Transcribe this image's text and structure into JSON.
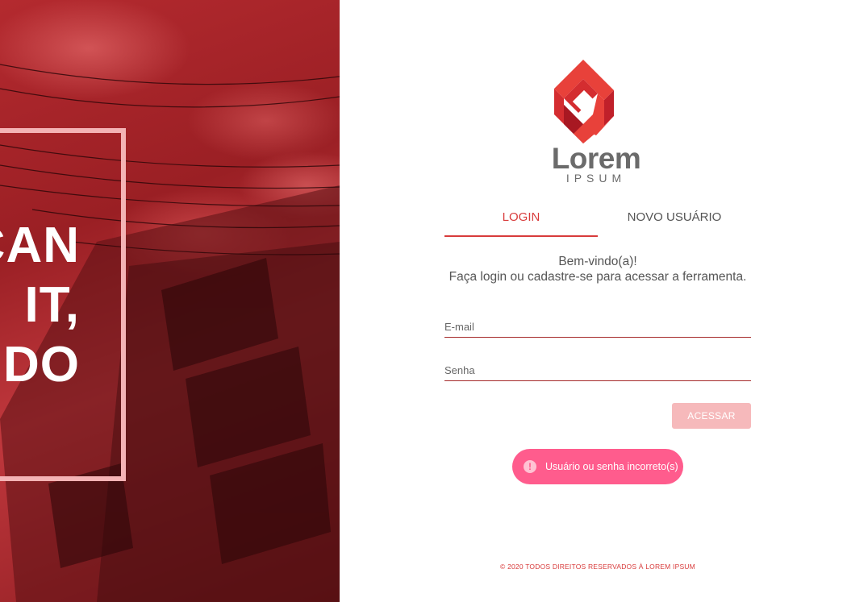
{
  "hero": {
    "lines": [
      "CAN",
      "IT,",
      "DO"
    ]
  },
  "brand": {
    "name": "Lorem",
    "subtitle": "IPSUM",
    "logo_icon": "house-logo-icon"
  },
  "tabs": [
    {
      "label": "LOGIN",
      "active": true
    },
    {
      "label": "NOVO USUÁRIO",
      "active": false
    }
  ],
  "welcome": {
    "line1": "Bem-vindo(a)!",
    "line2": "Faça login ou cadastre-se para acessar a ferramenta."
  },
  "form": {
    "email_placeholder": "E-mail",
    "email_value": "",
    "password_placeholder": "Senha",
    "password_value": "",
    "submit_label": "ACESSAR"
  },
  "toast": {
    "icon": "alert-icon",
    "message": "Usuário ou senha incorreto(s)"
  },
  "footer": {
    "text": "© 2020 TODOS DIREITOS RESERVADOS À LOREM IPSUM"
  },
  "colors": {
    "accent": "#d83b3b",
    "button_disabled": "#f6b9bb",
    "toast": "#ff5c8d",
    "hero_frame": "#f4b3b5"
  }
}
